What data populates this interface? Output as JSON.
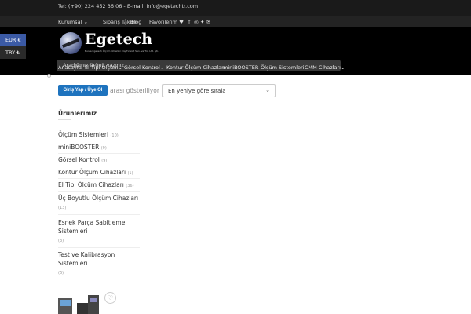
{
  "topbar": {
    "contact": "Tel: (+90) 224 452 36 06 - E-mail: info@egetechtr.com"
  },
  "topnav": {
    "items": [
      {
        "label": "Kurumsal"
      },
      {
        "label": "Sipariş Takibi"
      },
      {
        "label": "Blog"
      },
      {
        "label": "Favorilerim"
      }
    ],
    "social_icons": [
      "facebook-icon",
      "instagram-icon",
      "twitter-icon",
      "email-icon"
    ]
  },
  "logo": {
    "brand": "Egetech",
    "tagline": "Bursa Egetech Ölçüm Cihazları Dış Ticaret San. ve Tic. Ltd. Şti."
  },
  "search": {
    "placeholder": "Aradığınız ürünü yazınız"
  },
  "mainmenu": {
    "items": [
      {
        "label": "Anasayfa"
      },
      {
        "label": "El Tipi Ölçüm"
      },
      {
        "label": "Görsel Kontrol"
      },
      {
        "label": "Kontur Ölçüm Cihazları"
      },
      {
        "label": "miniBOOSTER"
      },
      {
        "label": "Ölçüm Sistemleri"
      },
      {
        "label": "CMM Cihazları"
      }
    ]
  },
  "currency": {
    "eur": "EUR €",
    "try": "TRY ₺"
  },
  "toolbar": {
    "login_label": "Giriş Yap / Üye Ol",
    "show_text": "arası gösteriliyor",
    "sort_value": "En yeniye göre sırala"
  },
  "sidebar": {
    "title": "Ürünlerimiz",
    "categories": [
      {
        "name": "Ölçüm Sistemleri",
        "count": "(10)"
      },
      {
        "name": "miniBOOSTER",
        "count": "(9)"
      },
      {
        "name": "Görsel Kontrol",
        "count": "(9)"
      },
      {
        "name": "Kontur Ölçüm Cihazları",
        "count": "(1)"
      },
      {
        "name": "El Tipi Ölçüm Cihazları",
        "count": "(36)"
      },
      {
        "name": "Üç Boyutlu Ölçüm Cihazları",
        "count": "(13)"
      },
      {
        "name": "Esnek Parça Sabitleme Sistemleri",
        "count": "(3)"
      },
      {
        "name": "Test ve Kalibrasyon Sistemleri",
        "count": "(6)"
      }
    ]
  },
  "colors": {
    "brand_blue": "#1e73be",
    "currency_active": "#3b5aa5",
    "header_bg": "#000000"
  }
}
